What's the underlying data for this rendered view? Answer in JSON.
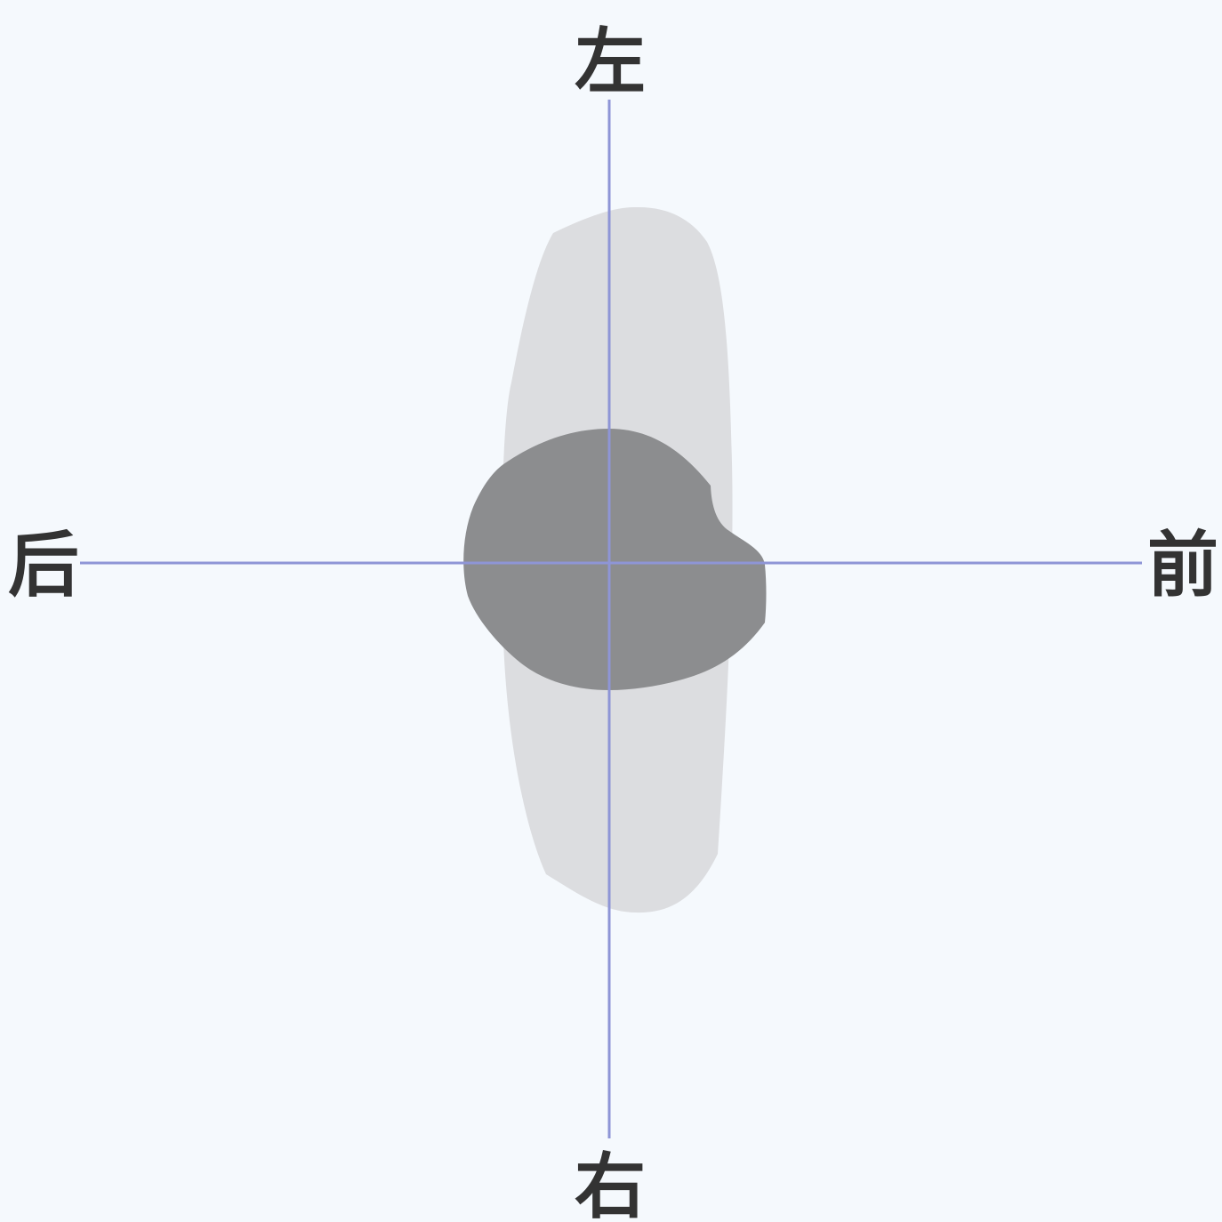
{
  "labels": {
    "top": "左",
    "bottom": "右",
    "left": "后",
    "right": "前"
  },
  "colors": {
    "background": "#f5f9fd",
    "axis": "#8e95d6",
    "outer_region": "#dcdde0",
    "inner_region": "#8c8d8f",
    "label": "#333333"
  }
}
